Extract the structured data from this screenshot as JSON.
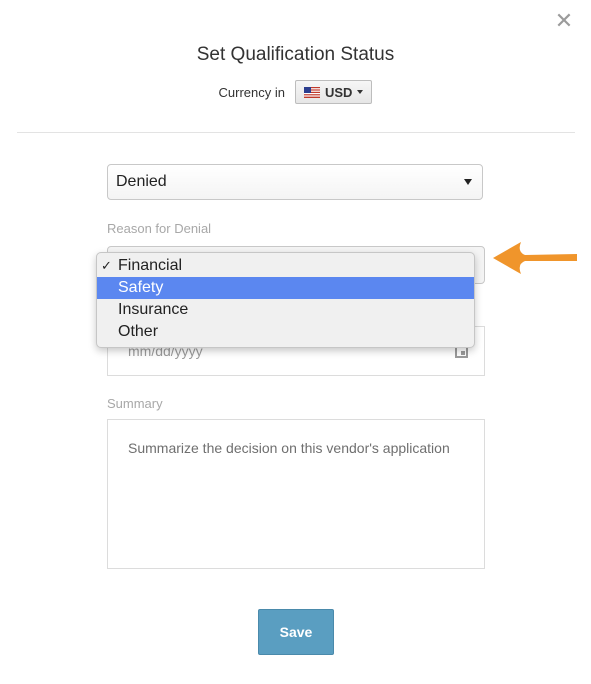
{
  "modal": {
    "title": "Set Qualification Status",
    "close_label": "✕"
  },
  "currency": {
    "label": "Currency in",
    "value": "USD"
  },
  "status_select": {
    "value": "Denied"
  },
  "reason": {
    "label": "Reason for Denial",
    "options": [
      "Financial",
      "Safety",
      "Insurance",
      "Other"
    ],
    "checked": "Financial",
    "highlighted": "Safety",
    "check_mark": "✓"
  },
  "date": {
    "placeholder": "mm/dd/yyyy"
  },
  "summary": {
    "label": "Summary",
    "placeholder": "Summarize the decision on this vendor's application"
  },
  "actions": {
    "save_label": "Save"
  },
  "colors": {
    "save_button": "#5a9ec1",
    "highlight": "#5b87f0",
    "arrow": "#f0952b"
  }
}
